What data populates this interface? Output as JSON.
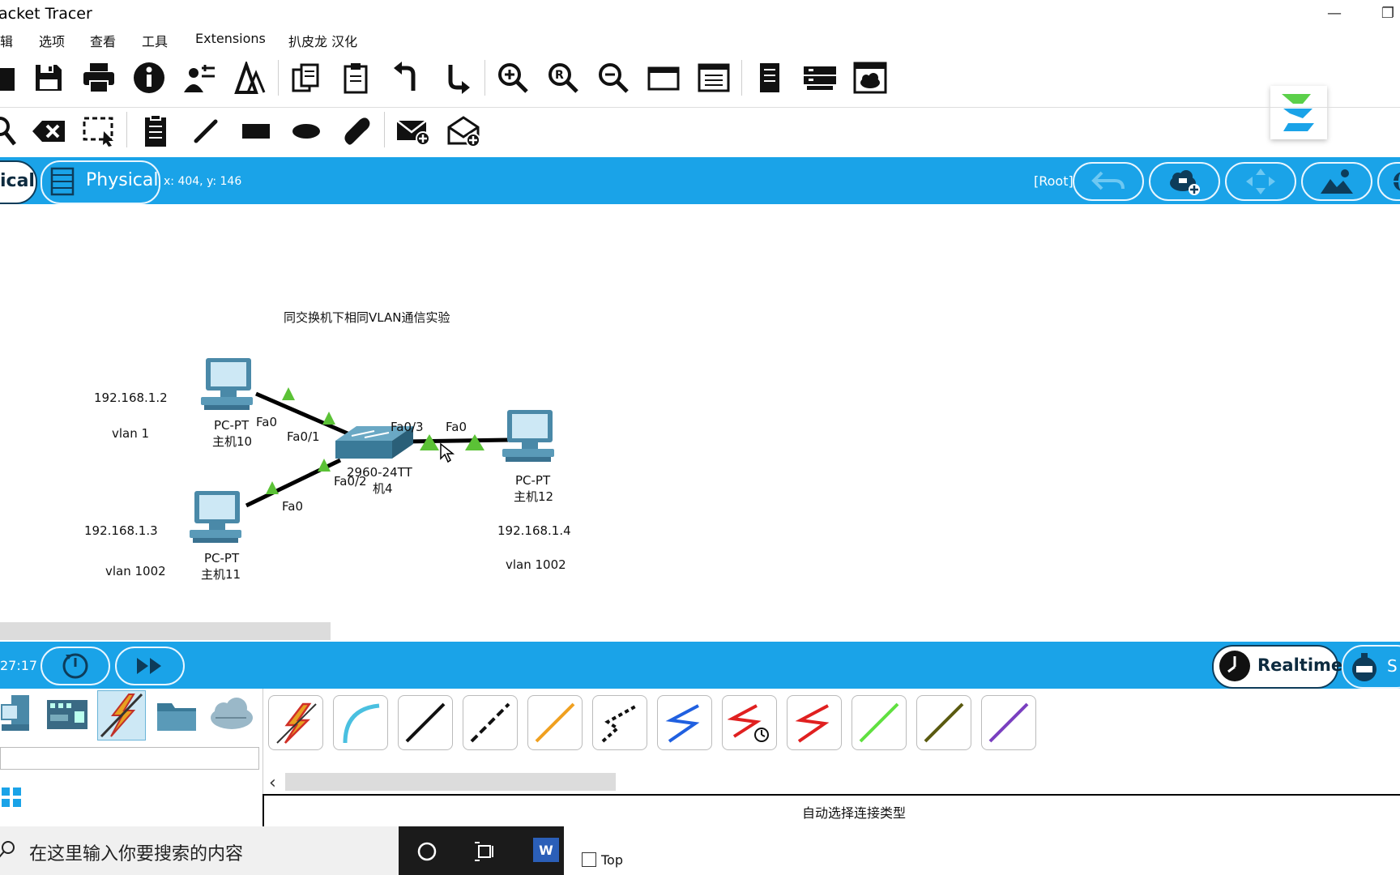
{
  "window": {
    "title": "acket Tracer",
    "minimize_glyph": "—",
    "restore_glyph": "❐"
  },
  "menu": {
    "items": [
      "辑",
      "选项",
      "查看",
      "工具",
      "Extensions",
      "扒皮龙 汉化"
    ]
  },
  "toolbar1": {
    "icons": [
      "new-icon",
      "save-icon",
      "print-icon",
      "info-icon",
      "network-wizard-icon",
      "activity-wizard-icon",
      "copy-icon",
      "paste-icon",
      "undo-icon",
      "redo-icon",
      "zoom-in-icon",
      "zoom-reset-icon",
      "zoom-out-icon",
      "drawing-palette-icon",
      "custom-device-dialog-icon",
      "notes-icon",
      "device-template-icon",
      "cloud-view-icon"
    ]
  },
  "toolbar2": {
    "icons": [
      "inspect-icon",
      "delete-icon",
      "select-icon",
      "note-icon",
      "line-icon",
      "rectangle-icon",
      "ellipse-icon",
      "freeform-icon",
      "add-simple-pdu-icon",
      "add-complex-pdu-icon"
    ]
  },
  "workspace_bar": {
    "logical_tab": "ical",
    "physical_tab": "Physical",
    "coordinates": "x: 404, y: 146",
    "root_label": "[Root]",
    "right_icons": [
      "back-icon",
      "new-cluster-icon",
      "move-object-icon",
      "background-icon",
      "viewport-icon"
    ]
  },
  "topology": {
    "title": "同交换机下相同VLAN通信实验",
    "pc10": {
      "type": "PC-PT",
      "name": "主机10",
      "ip": "192.168.1.2",
      "vlan": "vlan 1",
      "port": "Fa0"
    },
    "pc11": {
      "type": "PC-PT",
      "name": "主机11",
      "ip": "192.168.1.3",
      "vlan": "vlan 1002",
      "port": "Fa0"
    },
    "pc12": {
      "type": "PC-PT",
      "name": "主机12",
      "ip": "192.168.1.4",
      "vlan": "vlan 1002",
      "port": "Fa0"
    },
    "switch": {
      "model": "2960-24TT",
      "name": "机4",
      "port1": "Fa0/1",
      "port2": "Fa0/2",
      "port3": "Fa0/3"
    },
    "link_color": "#000000",
    "link_light_color": "#5bc236"
  },
  "sim_bar": {
    "time": "27:17",
    "reset_icon": "power-cycle-icon",
    "fast_forward_icon": "fast-forward-icon",
    "realtime_label": "Realtime",
    "simulation_label": "S"
  },
  "device_types": [
    "end-devices-icon",
    "network-devices-icon",
    "connections-icon",
    "misc-icon",
    "multiuser-icon"
  ],
  "cables": [
    "auto-connection-icon",
    "console-cable-icon",
    "copper-straight-icon",
    "copper-cross-icon",
    "fiber-icon",
    "phone-cable-icon",
    "coaxial-icon",
    "serial-dce-icon",
    "serial-dte-icon",
    "octal-icon",
    "iot-custom-icon",
    "usb-icon"
  ],
  "cable_scroll_arrow": "‹",
  "status_text": "自动选择连接类型",
  "taskbar": {
    "search_placeholder": "在这里输入你要搜索的内容",
    "top_label": "Top",
    "word_letter": "W"
  },
  "colors": {
    "accent_blue": "#1aa3e8",
    "dark_navy": "#0d3c5a"
  }
}
